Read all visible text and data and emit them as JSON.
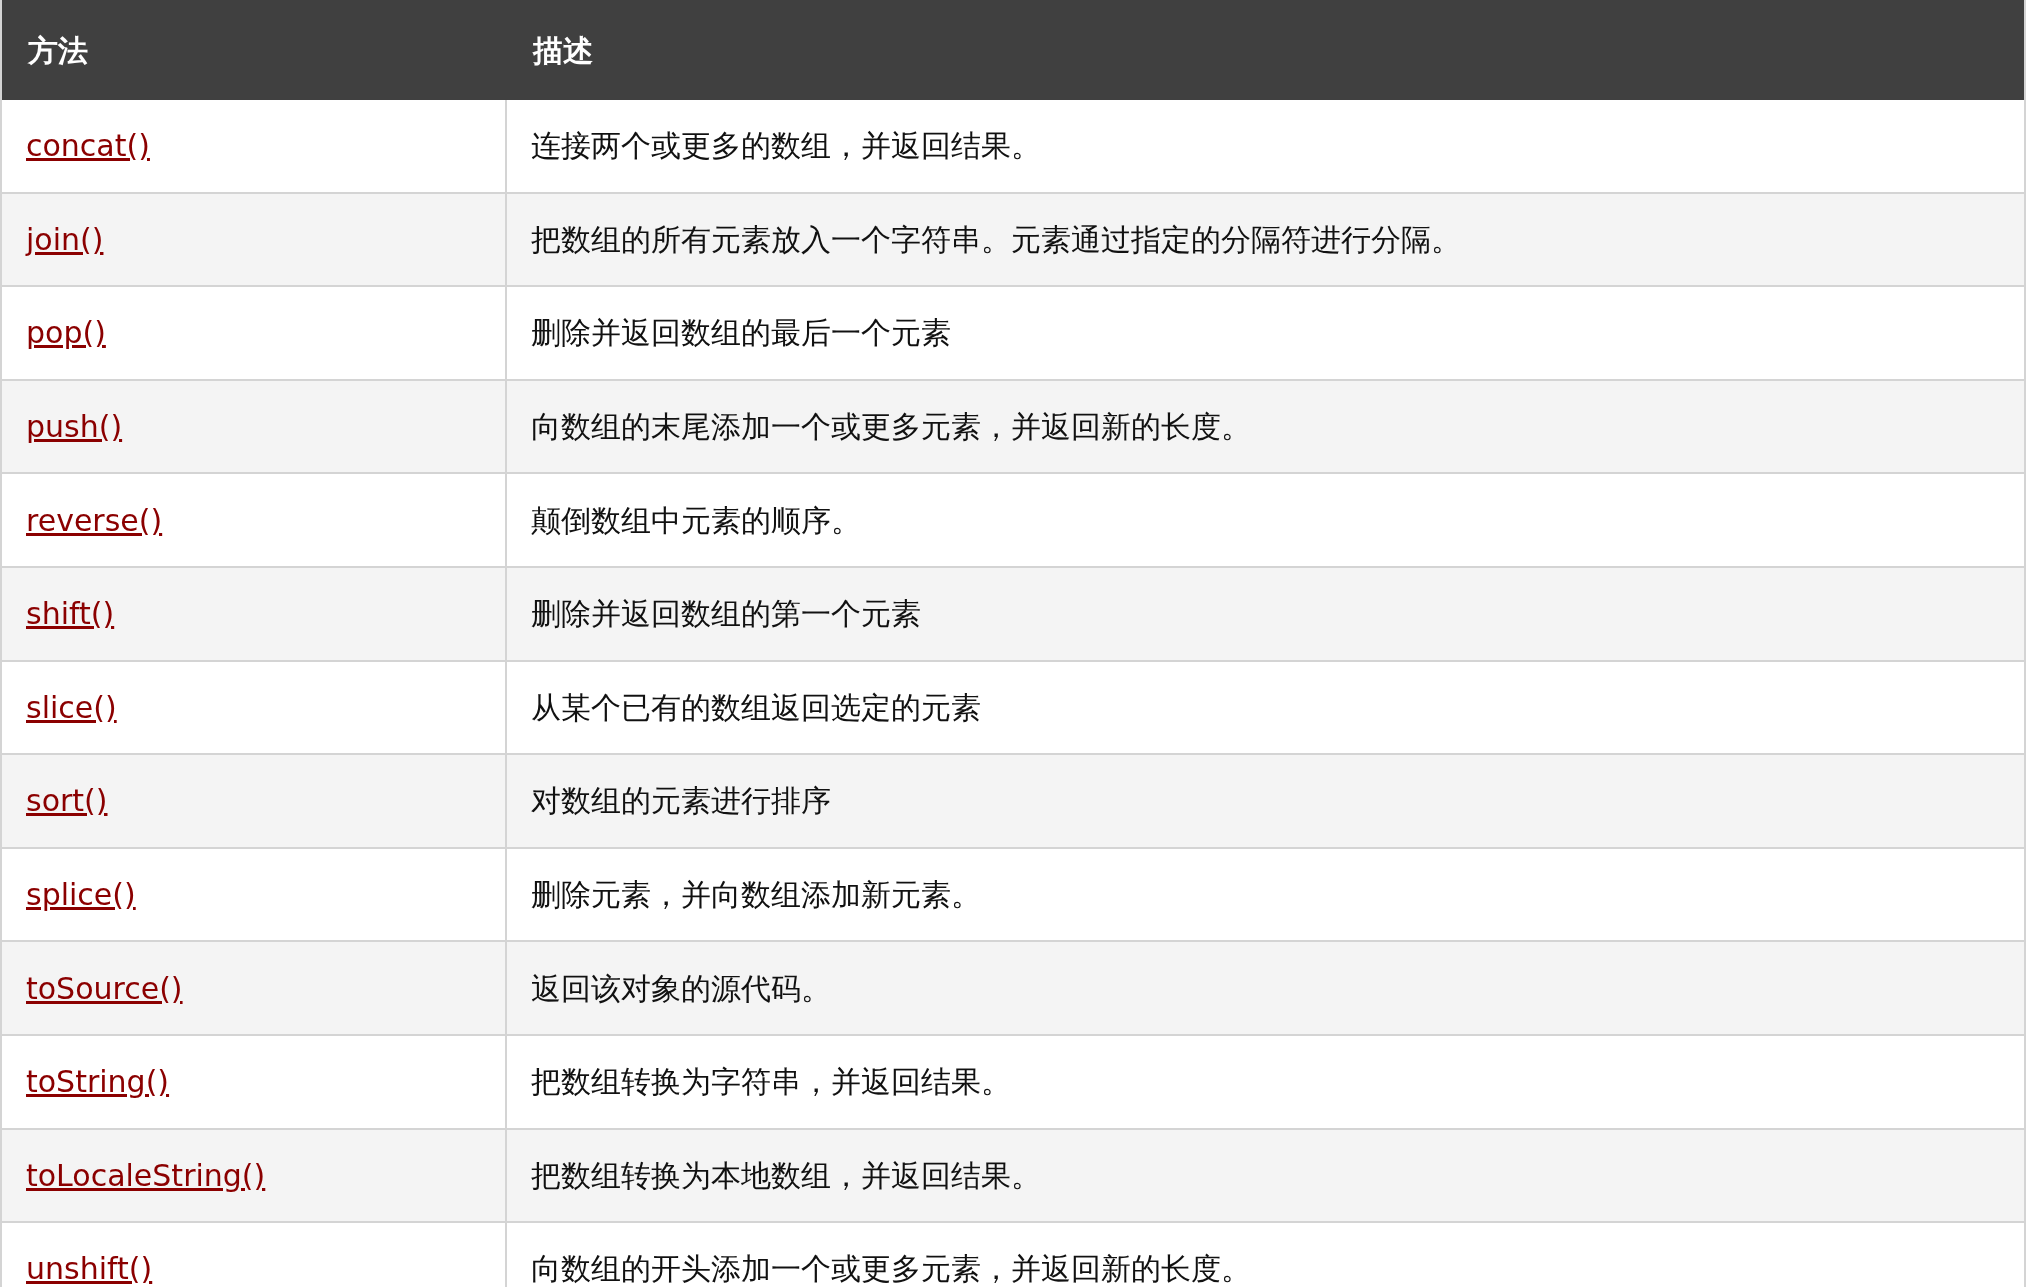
{
  "table": {
    "columns": [
      "方法",
      "描述"
    ],
    "rows": [
      {
        "method": "concat()",
        "description": "连接两个或更多的数组，并返回结果。"
      },
      {
        "method": "join()",
        "description": "把数组的所有元素放入一个字符串。元素通过指定的分隔符进行分隔。"
      },
      {
        "method": "pop()",
        "description": "删除并返回数组的最后一个元素"
      },
      {
        "method": "push()",
        "description": "向数组的末尾添加一个或更多元素，并返回新的长度。"
      },
      {
        "method": "reverse()",
        "description": "颠倒数组中元素的顺序。"
      },
      {
        "method": "shift()",
        "description": "删除并返回数组的第一个元素"
      },
      {
        "method": "slice()",
        "description": "从某个已有的数组返回选定的元素"
      },
      {
        "method": "sort()",
        "description": "对数组的元素进行排序"
      },
      {
        "method": "splice()",
        "description": "删除元素，并向数组添加新元素。"
      },
      {
        "method": "toSource()",
        "description": "返回该对象的源代码。"
      },
      {
        "method": "toString()",
        "description": "把数组转换为字符串，并返回结果。"
      },
      {
        "method": "toLocaleString()",
        "description": "把数组转换为本地数组，并返回结果。"
      },
      {
        "method": "unshift()",
        "description": "向数组的开头添加一个或更多元素，并返回新的长度。"
      }
    ]
  }
}
